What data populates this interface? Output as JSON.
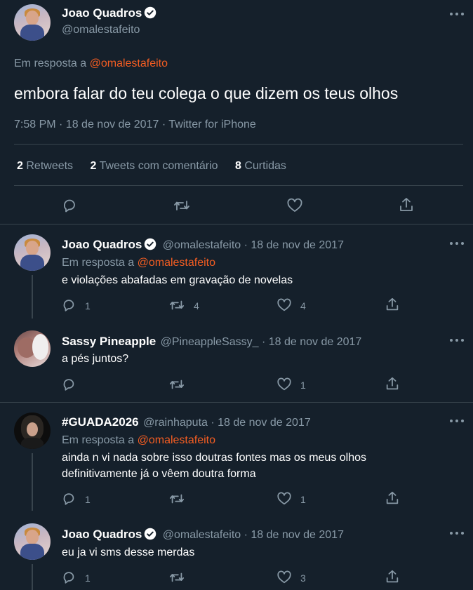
{
  "main_tweet": {
    "author_name": "Joao Quadros",
    "author_handle": "@omalestafeito",
    "reply_prefix": "Em resposta a",
    "reply_to": "@omalestafeito",
    "text": "embora falar do teu colega o que dizem os teus olhos",
    "meta": "7:58 PM · 18 de nov de 2017 · Twitter for iPhone",
    "stats": {
      "retweets_count": "2",
      "retweets_label": "Retweets",
      "quotes_count": "2",
      "quotes_label": "Tweets com comentário",
      "likes_count": "8",
      "likes_label": "Curtidas"
    }
  },
  "replies": [
    {
      "author_name": "Joao Quadros",
      "author_handle": "@omalestafeito",
      "date": "· 18 de nov de 2017",
      "reply_prefix": "Em resposta a",
      "reply_to": "@omalestafeito",
      "text": "e violações abafadas em gravação de novelas",
      "reply_count": "1",
      "retweet_count": "4",
      "like_count": "4"
    },
    {
      "author_name": "Sassy Pineapple",
      "author_handle": "@PineappleSassy_",
      "date": "· 18 de nov de 2017",
      "text": "a pés juntos?",
      "reply_count": "",
      "retweet_count": "",
      "like_count": "1"
    },
    {
      "author_name": "#GUADA2026",
      "author_handle": "@rainhaputa",
      "date": "· 18 de nov de 2017",
      "reply_prefix": "Em resposta a",
      "reply_to": "@omalestafeito",
      "text_line1": "ainda n vi nada sobre isso doutras fontes mas os meus olhos",
      "text_line2": "definitivamente já o vêem doutra forma",
      "reply_count": "1",
      "retweet_count": "",
      "like_count": "1"
    },
    {
      "author_name": "Joao Quadros",
      "author_handle": "@omalestafeito",
      "date": "· 18 de nov de 2017",
      "text": "eu ja vi sms desse merdas",
      "reply_count": "1",
      "retweet_count": "",
      "like_count": "3"
    }
  ],
  "colors": {
    "background": "#15202b",
    "accent_link": "#f45d22",
    "muted_text": "#8899a6",
    "divider": "#38444d"
  },
  "icons": [
    "verified-badge-icon",
    "more-icon",
    "reply-icon",
    "retweet-icon",
    "like-icon",
    "share-icon"
  ]
}
